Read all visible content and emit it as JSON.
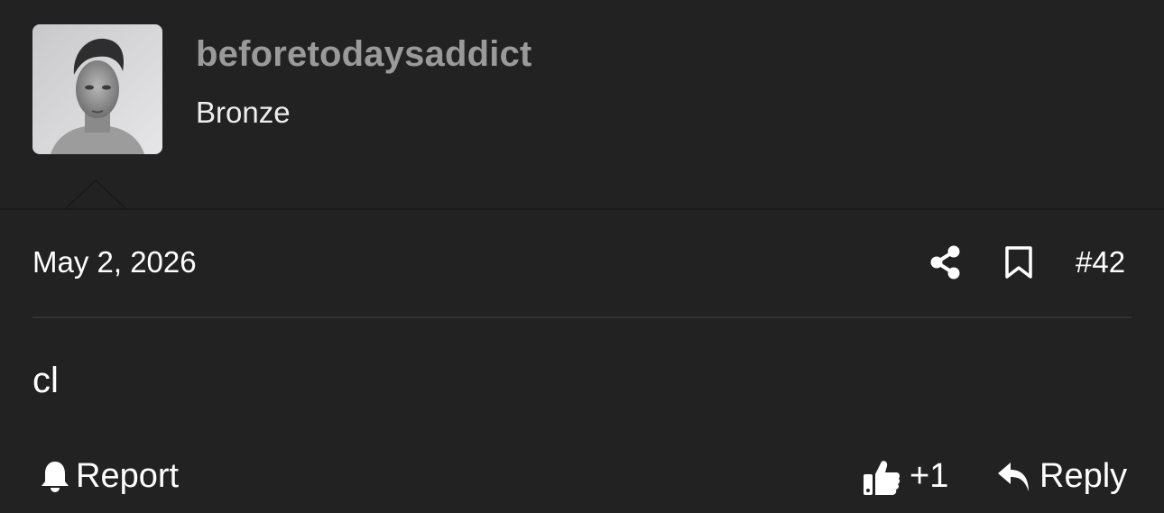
{
  "user": {
    "username": "beforetodaysaddict",
    "title": "Bronze",
    "avatar_icon": "user-avatar-photo"
  },
  "post": {
    "date": "May 2, 2026",
    "number": "#42",
    "body": "cl",
    "share_icon": "share-icon",
    "bookmark_icon": "bookmark-icon"
  },
  "actions": {
    "report_label": "Report",
    "report_icon": "bell-icon",
    "like_count": "+1",
    "like_icon": "thumbs-up-icon",
    "reply_label": "Reply",
    "reply_icon": "reply-arrow-icon"
  },
  "colors": {
    "background": "#222222",
    "username": "#9a9a9a",
    "text": "#ffffff",
    "divider": "#333333"
  }
}
